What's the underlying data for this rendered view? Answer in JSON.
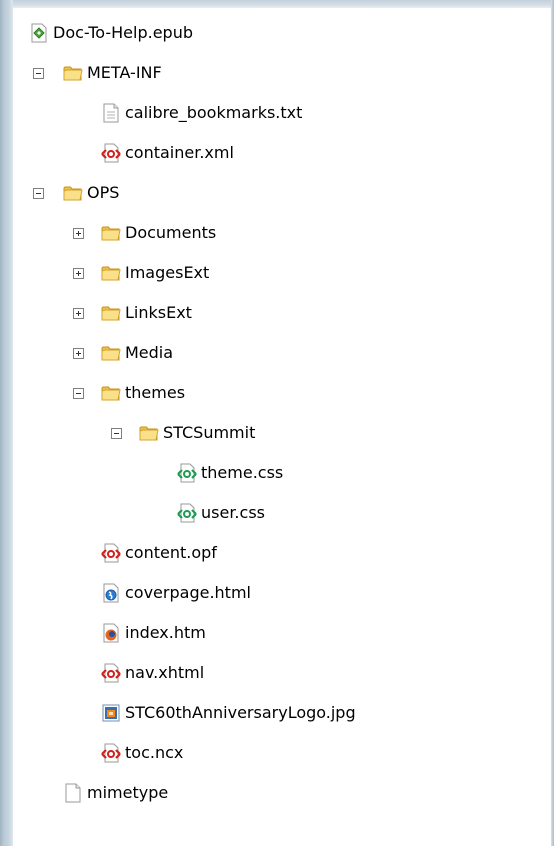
{
  "tree": {
    "items": [
      {
        "label": "Doc-To-Help.epub",
        "icon": "epub-file-icon",
        "toggle": "none",
        "level": 0
      },
      {
        "label": "META-INF",
        "icon": "folder-icon",
        "toggle": "expanded",
        "level": 0
      },
      {
        "label": "calibre_bookmarks.txt",
        "icon": "text-file-icon",
        "toggle": "none",
        "level": 1
      },
      {
        "label": "container.xml",
        "icon": "xml-file-icon",
        "toggle": "none",
        "level": 1
      },
      {
        "label": "OPS",
        "icon": "folder-icon",
        "toggle": "expanded",
        "level": 0
      },
      {
        "label": "Documents",
        "icon": "folder-icon",
        "toggle": "collapsed",
        "level": 1
      },
      {
        "label": "ImagesExt",
        "icon": "folder-icon",
        "toggle": "collapsed",
        "level": 1
      },
      {
        "label": "LinksExt",
        "icon": "folder-icon",
        "toggle": "collapsed",
        "level": 1
      },
      {
        "label": "Media",
        "icon": "folder-icon",
        "toggle": "collapsed",
        "level": 1
      },
      {
        "label": "themes",
        "icon": "folder-icon",
        "toggle": "expanded",
        "level": 1
      },
      {
        "label": "STCSummit",
        "icon": "folder-icon",
        "toggle": "expanded",
        "level": 2
      },
      {
        "label": "theme.css",
        "icon": "css-file-icon",
        "toggle": "none",
        "level": 3
      },
      {
        "label": "user.css",
        "icon": "css-file-icon",
        "toggle": "none",
        "level": 3
      },
      {
        "label": "content.opf",
        "icon": "xml-file-icon",
        "toggle": "none",
        "level": 1
      },
      {
        "label": "coverpage.html",
        "icon": "html-file-icon",
        "toggle": "none",
        "level": 1
      },
      {
        "label": "index.htm",
        "icon": "firefox-file-icon",
        "toggle": "none",
        "level": 1
      },
      {
        "label": "nav.xhtml",
        "icon": "xml-file-icon",
        "toggle": "none",
        "level": 1
      },
      {
        "label": "STC60thAnniversaryLogo.jpg",
        "icon": "image-file-icon",
        "toggle": "none",
        "level": 1
      },
      {
        "label": "toc.ncx",
        "icon": "xml-file-icon",
        "toggle": "none",
        "level": 1
      },
      {
        "label": "mimetype",
        "icon": "blank-file-icon",
        "toggle": "none",
        "level": 0
      }
    ]
  },
  "colors": {
    "folder": "#f7d774",
    "xml": "#cc2200",
    "css": "#22a05a",
    "epub": "#4aa83a"
  }
}
